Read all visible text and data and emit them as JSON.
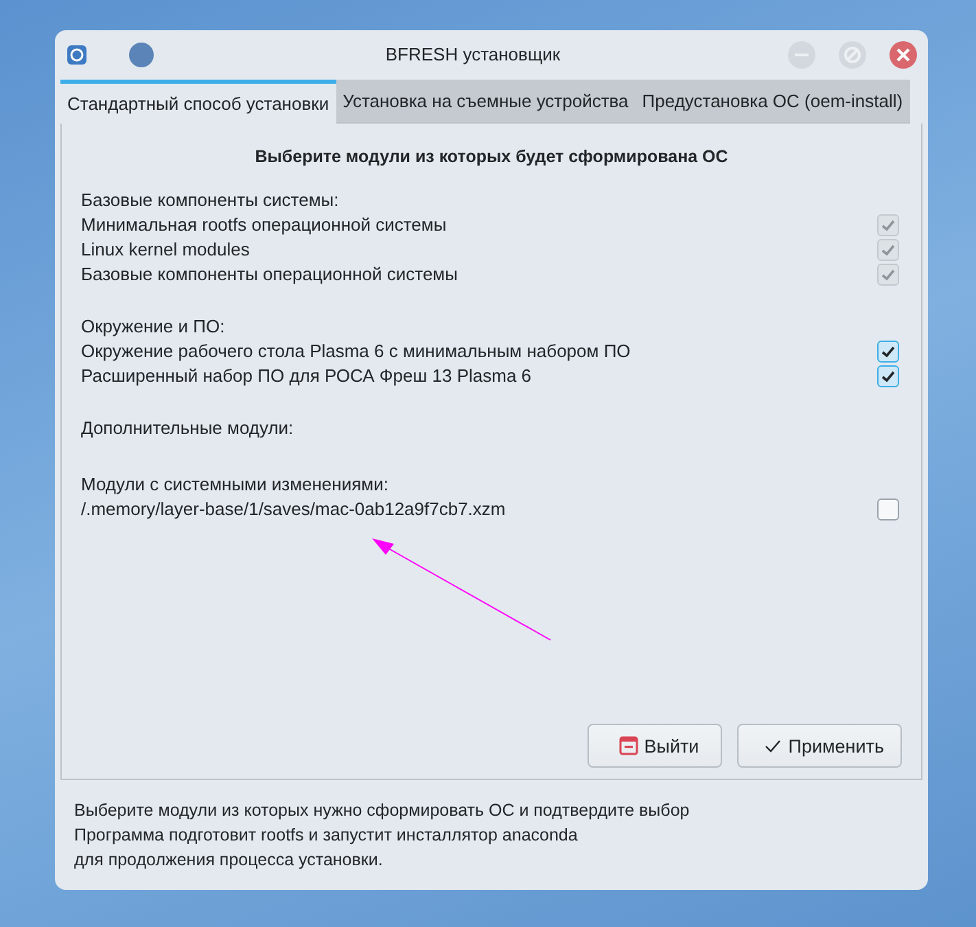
{
  "window": {
    "title": "BFRESH установщик"
  },
  "tabs": [
    {
      "label": "Стандартный способ установки",
      "selected": true
    },
    {
      "label": "Установка на съемные устройства",
      "selected": false
    },
    {
      "label": "Предустановка ОС (oem-install)",
      "selected": false
    }
  ],
  "heading": "Выберите модули из которых будет сформирована ОС",
  "sections": [
    {
      "title": "Базовые компоненты системы:",
      "items": [
        {
          "label": "Минимальная rootfs операционной системы",
          "checked": true,
          "disabled": true
        },
        {
          "label": "Linux kernel modules",
          "checked": true,
          "disabled": true
        },
        {
          "label": "Базовые компоненты операционной системы",
          "checked": true,
          "disabled": true
        }
      ]
    },
    {
      "title": "Окружение и ПО:",
      "items": [
        {
          "label": "Окружение рабочего стола Plasma 6 с минимальным набором ПО",
          "checked": true,
          "disabled": false
        },
        {
          "label": "Расширенный набор ПО для РОСА Фреш 13 Plasma 6",
          "checked": true,
          "disabled": false
        }
      ]
    },
    {
      "title": "Дополнительные модули:"
    },
    {
      "title": "Модули с системными изменениями:",
      "items": [
        {
          "label": "/.memory/layer-base/1/saves/mac-0ab12a9f7cb7.xzm",
          "checked": false,
          "disabled": false
        }
      ]
    }
  ],
  "buttons": [
    {
      "label": "Выйти",
      "kind": "quit"
    },
    {
      "label": "Применить",
      "kind": "apply"
    }
  ],
  "footer_lines": [
    "Выберите модули из которых нужно сформировать ОС и подтвердите выбор",
    "Программа  подготовит rootfs и запустит инсталлятор anaconda",
    "для продолжения процесса установки."
  ]
}
